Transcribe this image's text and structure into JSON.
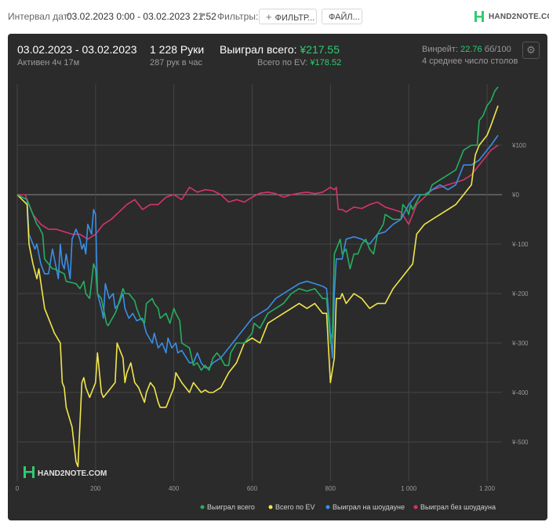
{
  "toolbar": {
    "date_label": "Интервал дат:",
    "date_value": "03.02.2023 0:00 - 03.02.2023 21:52",
    "filters_label": "Фильтры:",
    "filter_button": "ФИЛЬТР...",
    "file_button": "ФАЙЛ...",
    "logo_text": "HAND2NOTE.COM"
  },
  "summary": {
    "date_range": "03.02.2023 - 03.02.2023",
    "active": "Активен 4ч 17м",
    "hands": "1 228 Руки",
    "hands_per_hour": "287 рук в час",
    "won_label": "Выиграл всего:",
    "won_value": "¥217.55",
    "ev_label": "Всего по EV:",
    "ev_value": "¥178.52",
    "winrate_label": "Винрейт:",
    "winrate_value": "22.76",
    "winrate_unit": "бб/100",
    "tables": "4 среднее число столов"
  },
  "watermark": "HAND2NOTE.COM",
  "colors": {
    "total": "#27ae60",
    "ev": "#f1e64b",
    "showdown": "#3a8ee6",
    "non_showdown": "#d6336c",
    "panel_bg": "#2b2b2b",
    "grid": "#444444"
  },
  "chart_data": {
    "type": "line",
    "xlim": [
      0,
      1228
    ],
    "ylim": [
      -555,
      220
    ],
    "x_ticks": [
      0,
      200,
      400,
      600,
      800,
      1000,
      1200
    ],
    "x_tick_labels": [
      "0",
      "200",
      "400",
      "600",
      "800",
      "1 000",
      "1 200"
    ],
    "y_ticks": [
      100,
      0,
      -100,
      -200,
      -300,
      -400,
      -500
    ],
    "y_tick_labels": [
      "¥100",
      "¥0",
      "¥-100",
      "¥-200",
      "¥-300",
      "¥-400",
      "¥-500"
    ],
    "grid": true,
    "legend_position": "bottom-right",
    "series": [
      {
        "name": "Выиграл всего",
        "key": "total",
        "x": [
          0,
          25,
          30,
          50,
          55,
          65,
          70,
          90,
          95,
          120,
          125,
          150,
          160,
          170,
          175,
          185,
          195,
          200,
          205,
          215,
          220,
          228,
          232,
          250,
          255,
          270,
          275,
          285,
          300,
          305,
          315,
          325,
          330,
          345,
          350,
          360,
          365,
          380,
          390,
          400,
          405,
          415,
          420,
          440,
          450,
          460,
          470,
          480,
          490,
          500,
          510,
          520,
          530,
          540,
          545,
          560,
          580,
          600,
          605,
          620,
          640,
          660,
          680,
          700,
          720,
          740,
          760,
          780,
          790,
          800,
          805,
          810,
          815,
          825,
          830,
          840,
          850,
          860,
          870,
          880,
          890,
          900,
          910,
          920,
          935,
          940,
          960,
          980,
          985,
          995,
          1000,
          1005,
          1010,
          1030,
          1050,
          1060,
          1080,
          1100,
          1120,
          1140,
          1160,
          1175,
          1180,
          1190,
          1200,
          1210,
          1220,
          1228
        ],
        "y": [
          0,
          -10,
          -20,
          -60,
          -65,
          -80,
          -130,
          -150,
          -150,
          -160,
          -175,
          -180,
          -190,
          -175,
          -200,
          -210,
          -140,
          -150,
          -200,
          -210,
          -230,
          -260,
          -265,
          -240,
          -230,
          -190,
          -200,
          -200,
          -215,
          -230,
          -250,
          -260,
          -220,
          -210,
          -220,
          -230,
          -250,
          -240,
          -260,
          -230,
          -240,
          -255,
          -300,
          -310,
          -345,
          -340,
          -355,
          -345,
          -355,
          -330,
          -320,
          -330,
          -345,
          -345,
          -320,
          -300,
          -300,
          -280,
          -260,
          -270,
          -240,
          -230,
          -220,
          -200,
          -190,
          -195,
          -190,
          -210,
          -210,
          -300,
          -280,
          -120,
          -110,
          -90,
          -120,
          -110,
          -150,
          -120,
          -120,
          -100,
          -90,
          -110,
          -120,
          -80,
          -60,
          -40,
          -50,
          -50,
          -20,
          -30,
          -40,
          -20,
          -30,
          0,
          0,
          20,
          30,
          40,
          50,
          90,
          100,
          100,
          150,
          160,
          180,
          190,
          210,
          218
        ]
      },
      {
        "name": "Всего по EV",
        "key": "ev",
        "x": [
          0,
          25,
          30,
          40,
          50,
          55,
          70,
          90,
          95,
          110,
          115,
          120,
          125,
          140,
          150,
          155,
          165,
          170,
          175,
          185,
          190,
          200,
          205,
          215,
          220,
          230,
          250,
          255,
          270,
          275,
          280,
          290,
          300,
          310,
          315,
          325,
          330,
          340,
          350,
          360,
          365,
          380,
          390,
          400,
          405,
          420,
          440,
          450,
          470,
          480,
          490,
          500,
          520,
          540,
          560,
          580,
          600,
          620,
          640,
          660,
          680,
          700,
          720,
          740,
          760,
          780,
          790,
          800,
          810,
          815,
          825,
          830,
          840,
          860,
          880,
          900,
          920,
          940,
          960,
          980,
          1000,
          1010,
          1020,
          1040,
          1060,
          1080,
          1100,
          1120,
          1140,
          1160,
          1170,
          1180,
          1200,
          1210,
          1228
        ],
        "y": [
          0,
          -20,
          -100,
          -140,
          -170,
          -150,
          -230,
          -270,
          -280,
          -300,
          -380,
          -390,
          -430,
          -470,
          -540,
          -550,
          -380,
          -370,
          -390,
          -410,
          -400,
          -380,
          -320,
          -400,
          -410,
          -400,
          -380,
          -300,
          -330,
          -380,
          -360,
          -340,
          -380,
          -390,
          -400,
          -420,
          -400,
          -380,
          -390,
          -420,
          -430,
          -430,
          -410,
          -390,
          -360,
          -380,
          -400,
          -380,
          -400,
          -395,
          -400,
          -400,
          -390,
          -360,
          -340,
          -300,
          -290,
          -300,
          -260,
          -250,
          -240,
          -230,
          -220,
          -230,
          -220,
          -240,
          -240,
          -380,
          -330,
          -210,
          -210,
          -200,
          -220,
          -200,
          -210,
          -230,
          -220,
          -220,
          -190,
          -170,
          -150,
          -140,
          -80,
          -60,
          -50,
          -40,
          -30,
          -20,
          0,
          20,
          80,
          100,
          120,
          140,
          180
        ]
      },
      {
        "name": "Выиграл на шоудауне",
        "key": "showdown",
        "x": [
          0,
          25,
          30,
          45,
          50,
          60,
          65,
          70,
          80,
          90,
          95,
          105,
          110,
          115,
          120,
          125,
          135,
          140,
          150,
          160,
          165,
          170,
          175,
          180,
          190,
          195,
          200,
          205,
          215,
          220,
          225,
          235,
          245,
          250,
          260,
          270,
          275,
          285,
          295,
          305,
          320,
          330,
          345,
          350,
          360,
          370,
          380,
          385,
          395,
          405,
          410,
          420,
          440,
          450,
          460,
          470,
          480,
          490,
          500,
          520,
          540,
          560,
          580,
          600,
          620,
          640,
          660,
          680,
          700,
          720,
          740,
          760,
          780,
          790,
          800,
          805,
          810,
          815,
          830,
          840,
          860,
          880,
          900,
          920,
          940,
          960,
          980,
          1000,
          1020,
          1040,
          1060,
          1080,
          1100,
          1120,
          1140,
          1160,
          1180,
          1200,
          1210,
          1228
        ],
        "y": [
          0,
          -10,
          -80,
          -110,
          -100,
          -140,
          -150,
          -160,
          -160,
          -110,
          -130,
          -170,
          -100,
          -140,
          -150,
          -120,
          -170,
          -90,
          -70,
          -90,
          -110,
          -100,
          -120,
          -60,
          -80,
          -30,
          -40,
          -200,
          -230,
          -250,
          -180,
          -210,
          -200,
          -230,
          -220,
          -200,
          -230,
          -250,
          -240,
          -255,
          -250,
          -280,
          -300,
          -280,
          -310,
          -300,
          -320,
          -290,
          -310,
          -300,
          -320,
          -315,
          -340,
          -340,
          -320,
          -340,
          -350,
          -350,
          -340,
          -330,
          -310,
          -290,
          -270,
          -250,
          -240,
          -230,
          -210,
          -200,
          -190,
          -180,
          -175,
          -180,
          -185,
          -190,
          -280,
          -330,
          -200,
          -130,
          -130,
          -90,
          -85,
          -90,
          -100,
          -80,
          -75,
          -60,
          -50,
          -20,
          0,
          0,
          10,
          20,
          10,
          20,
          60,
          60,
          70,
          90,
          100,
          120
        ]
      },
      {
        "name": "Выиграл без шоудауна",
        "key": "non_showdown",
        "x": [
          0,
          20,
          40,
          60,
          80,
          100,
          120,
          140,
          160,
          180,
          200,
          220,
          240,
          260,
          280,
          300,
          320,
          340,
          360,
          380,
          400,
          420,
          440,
          460,
          480,
          500,
          520,
          540,
          560,
          580,
          600,
          620,
          640,
          660,
          680,
          700,
          720,
          740,
          760,
          780,
          800,
          810,
          815,
          820,
          830,
          840,
          860,
          880,
          900,
          920,
          940,
          960,
          980,
          1000,
          1020,
          1040,
          1060,
          1080,
          1100,
          1120,
          1140,
          1160,
          1180,
          1200,
          1210,
          1228
        ],
        "y": [
          0,
          0,
          -40,
          -60,
          -70,
          -70,
          -75,
          -80,
          -80,
          -90,
          -80,
          -60,
          -50,
          -35,
          -20,
          -10,
          -30,
          -20,
          -20,
          -5,
          0,
          -10,
          15,
          5,
          10,
          8,
          0,
          -15,
          -10,
          -15,
          -5,
          3,
          5,
          2,
          -5,
          0,
          3,
          5,
          2,
          5,
          15,
          10,
          15,
          -30,
          -30,
          -35,
          -25,
          -28,
          -20,
          -15,
          -25,
          -30,
          -35,
          -60,
          -20,
          -5,
          10,
          15,
          20,
          25,
          30,
          40,
          60,
          80,
          90,
          100
        ]
      }
    ]
  }
}
